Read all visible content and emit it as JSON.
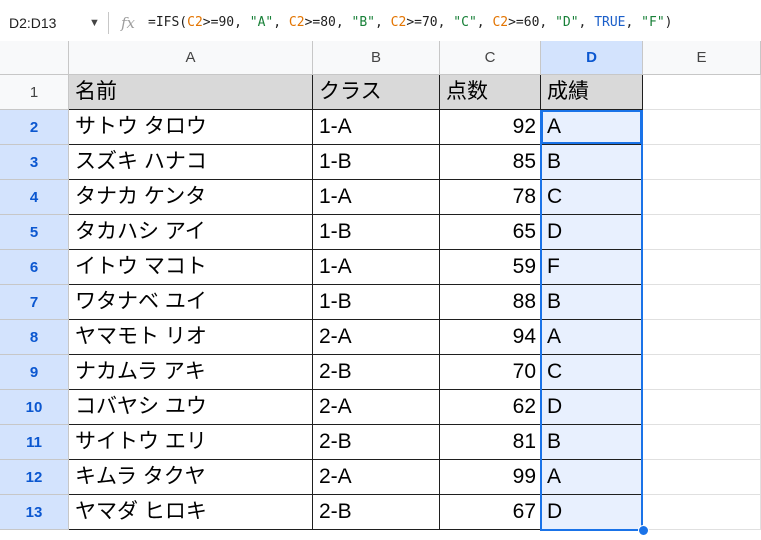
{
  "name_box": "D2:D13",
  "fx_label": "fx",
  "formula": {
    "parts": [
      {
        "t": "=IFS(",
        "c": ""
      },
      {
        "t": "C2",
        "c": "ref"
      },
      {
        "t": ">=90, ",
        "c": ""
      },
      {
        "t": "\"A\"",
        "c": "str"
      },
      {
        "t": ", ",
        "c": ""
      },
      {
        "t": "C2",
        "c": "ref"
      },
      {
        "t": ">=80, ",
        "c": ""
      },
      {
        "t": "\"B\"",
        "c": "str"
      },
      {
        "t": ", ",
        "c": ""
      },
      {
        "t": "C2",
        "c": "ref"
      },
      {
        "t": ">=70, ",
        "c": ""
      },
      {
        "t": "\"C\"",
        "c": "str"
      },
      {
        "t": ", ",
        "c": ""
      },
      {
        "t": "C2",
        "c": "ref"
      },
      {
        "t": ">=60, ",
        "c": ""
      },
      {
        "t": "\"D\"",
        "c": "str"
      },
      {
        "t": ", ",
        "c": ""
      },
      {
        "t": "TRUE",
        "c": "kw"
      },
      {
        "t": ", ",
        "c": ""
      },
      {
        "t": "\"F\"",
        "c": "str"
      },
      {
        "t": ")",
        "c": ""
      }
    ]
  },
  "columns": [
    "A",
    "B",
    "C",
    "D",
    "E"
  ],
  "selected_column": "D",
  "headers": [
    "名前",
    "クラス",
    "点数",
    "成績"
  ],
  "rows": [
    {
      "n": "2",
      "name": "サトウ タロウ",
      "cls": "1-A",
      "score": "92",
      "grade": "A"
    },
    {
      "n": "3",
      "name": "スズキ ハナコ",
      "cls": "1-B",
      "score": "85",
      "grade": "B"
    },
    {
      "n": "4",
      "name": "タナカ ケンタ",
      "cls": "1-A",
      "score": "78",
      "grade": "C"
    },
    {
      "n": "5",
      "name": "タカハシ アイ",
      "cls": "1-B",
      "score": "65",
      "grade": "D"
    },
    {
      "n": "6",
      "name": "イトウ マコト",
      "cls": "1-A",
      "score": "59",
      "grade": "F"
    },
    {
      "n": "7",
      "name": "ワタナベ ユイ",
      "cls": "1-B",
      "score": "88",
      "grade": "B"
    },
    {
      "n": "8",
      "name": "ヤマモト リオ",
      "cls": "2-A",
      "score": "94",
      "grade": "A"
    },
    {
      "n": "9",
      "name": "ナカムラ アキ",
      "cls": "2-B",
      "score": "70",
      "grade": "C"
    },
    {
      "n": "10",
      "name": "コバヤシ ユウ",
      "cls": "2-A",
      "score": "62",
      "grade": "D"
    },
    {
      "n": "11",
      "name": "サイトウ エリ",
      "cls": "2-B",
      "score": "81",
      "grade": "B"
    },
    {
      "n": "12",
      "name": "キムラ タクヤ",
      "cls": "2-A",
      "score": "99",
      "grade": "A"
    },
    {
      "n": "13",
      "name": "ヤマダ ヒロキ",
      "cls": "2-B",
      "score": "67",
      "grade": "D"
    }
  ],
  "colors": {
    "selection": "#1a73e8",
    "header_fill": "#d9d9d9",
    "selected_header": "#d3e3fd"
  }
}
